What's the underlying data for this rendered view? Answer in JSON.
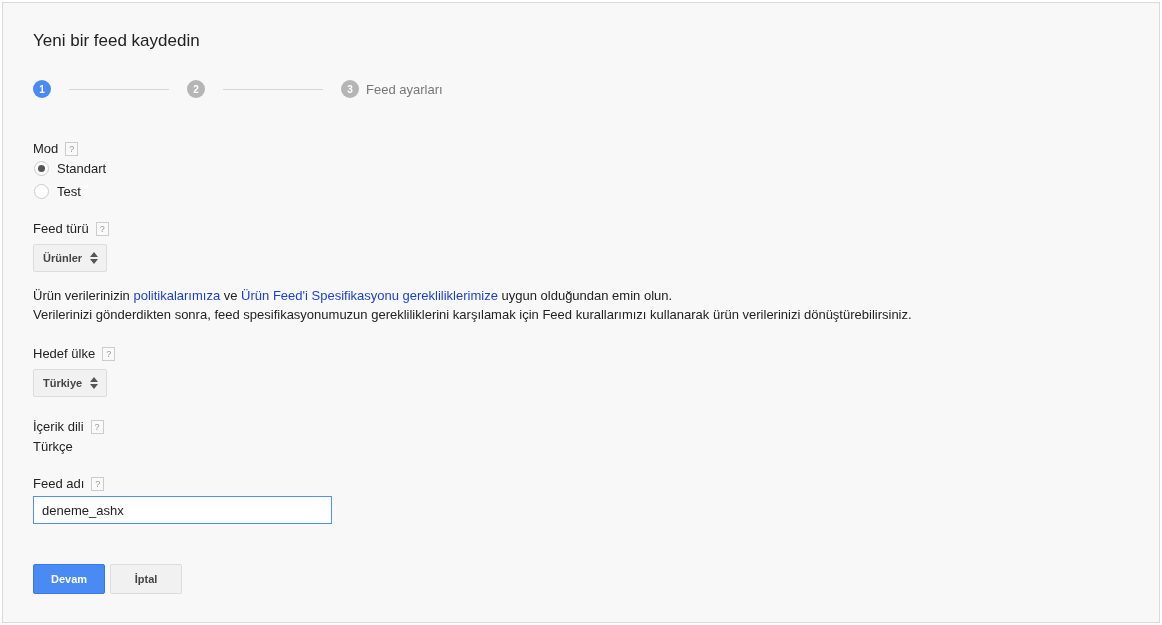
{
  "title": "Yeni bir feed kaydedin",
  "steps": [
    {
      "number": "1",
      "selected": true
    },
    {
      "number": "2",
      "selected": false
    },
    {
      "number": "3",
      "label": "Feed ayarları",
      "selected": false
    }
  ],
  "fields": [
    {
      "kind": "radio",
      "label": "Mod",
      "help": "?",
      "options": [
        {
          "label": "Standart",
          "selected": true
        },
        {
          "label": "Test",
          "selected": false
        }
      ]
    },
    {
      "kind": "select",
      "label": "Feed türü",
      "help": "?",
      "value": "Ürünler",
      "notes": [
        [
          {
            "text": "Ürün verilerinizin "
          },
          {
            "link": "politikalarımıza"
          },
          {
            "text": " ve "
          },
          {
            "link": "Ürün Feed'i Spesifikasyonu gerekliliklerimize"
          },
          {
            "text": " uygun olduğundan emin olun."
          }
        ],
        [
          {
            "text": "Verilerinizi gönderdikten sonra, feed spesifikasyonumuzun gerekliliklerini karşılamak için Feed kurallarımızı kullanarak ürün verilerinizi dönüştürebilirsiniz."
          }
        ]
      ]
    },
    {
      "kind": "select",
      "label": "Hedef ülke",
      "help": "?",
      "value": "Türkiye"
    },
    {
      "kind": "static",
      "label": "İçerik dili",
      "help": "?",
      "value": "Türkçe"
    },
    {
      "kind": "text",
      "label": "Feed adı",
      "help": "?",
      "value": "deneme_ashx"
    }
  ],
  "buttons": [
    {
      "label": "Devam",
      "kind": "primary"
    },
    {
      "label": "İptal",
      "kind": "secondary"
    }
  ]
}
